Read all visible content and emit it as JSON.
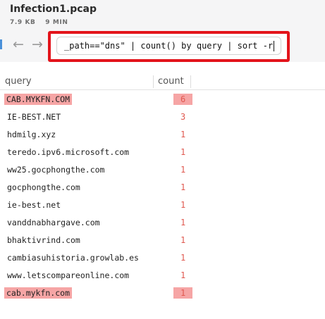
{
  "header": {
    "title": "Infection1.pcap",
    "size": "7.9 KB",
    "duration": "9 MIN"
  },
  "nav": {
    "back_icon": "←",
    "forward_icon": "→"
  },
  "search": {
    "query": "_path==\"dns\" | count() by query | sort -r"
  },
  "table": {
    "columns": [
      "query",
      "count"
    ],
    "rows": [
      {
        "query": "CAB.MYKFN.COM",
        "count": "6",
        "highlight": true
      },
      {
        "query": "IE-BEST.NET",
        "count": "3",
        "highlight": false
      },
      {
        "query": "hdmilg.xyz",
        "count": "1",
        "highlight": false
      },
      {
        "query": "teredo.ipv6.microsoft.com",
        "count": "1",
        "highlight": false
      },
      {
        "query": "ww25.gocphongthe.com",
        "count": "1",
        "highlight": false
      },
      {
        "query": "gocphongthe.com",
        "count": "1",
        "highlight": false
      },
      {
        "query": "ie-best.net",
        "count": "1",
        "highlight": false
      },
      {
        "query": "vanddnabhargave.com",
        "count": "1",
        "highlight": false
      },
      {
        "query": "bhaktivrind.com",
        "count": "1",
        "highlight": false
      },
      {
        "query": "cambiasuhistoria.growlab.es",
        "count": "1",
        "highlight": false
      },
      {
        "query": "www.letscompareonline.com",
        "count": "1",
        "highlight": false
      },
      {
        "query": "cab.mykfn.com",
        "count": "1",
        "highlight": true
      }
    ]
  }
}
